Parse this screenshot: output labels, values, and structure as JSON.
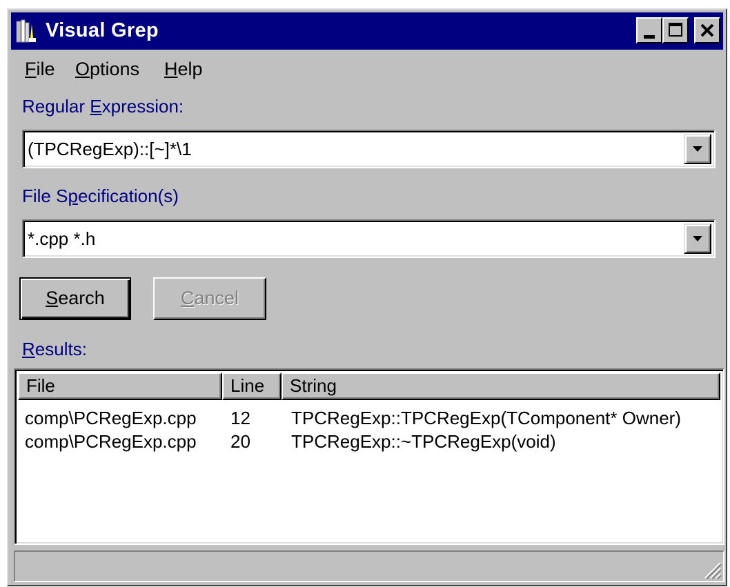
{
  "window": {
    "title": "Visual Grep",
    "app_icon": "visual-grep-icon",
    "caption_buttons": [
      "minimize-icon",
      "maximize-icon",
      "close-icon"
    ]
  },
  "menu": {
    "file": {
      "acc": "F",
      "rest": "ile"
    },
    "options": {
      "acc": "O",
      "rest": "ptions"
    },
    "help": {
      "acc": "H",
      "rest": "elp"
    }
  },
  "regex": {
    "label_pre": "Regular ",
    "label_acc": "E",
    "label_post": "xpression:",
    "value": "(TPCRegExp)::[~]*\\1"
  },
  "filespec": {
    "label_pre": "File S",
    "label_acc": "p",
    "label_post": "ecification(s)",
    "value": "*.cpp *.h"
  },
  "buttons": {
    "search": {
      "acc": "S",
      "rest": "earch"
    },
    "cancel": {
      "acc": "C",
      "rest": "ancel"
    }
  },
  "results": {
    "label_acc": "R",
    "label_post": "esults:",
    "columns": [
      "File",
      "Line",
      "String"
    ],
    "rows": [
      {
        "file": "comp\\PCRegExp.cpp",
        "line": "12",
        "string": "TPCRegExp::TPCRegExp(TComponent* Owner)"
      },
      {
        "file": "comp\\PCRegExp.cpp",
        "line": "20",
        "string": "TPCRegExp::~TPCRegExp(void)"
      }
    ]
  },
  "statusbar": {
    "text": ""
  },
  "colors": {
    "titlebar": "#000080",
    "face": "#c0c0c0",
    "label_text": "#000080"
  }
}
